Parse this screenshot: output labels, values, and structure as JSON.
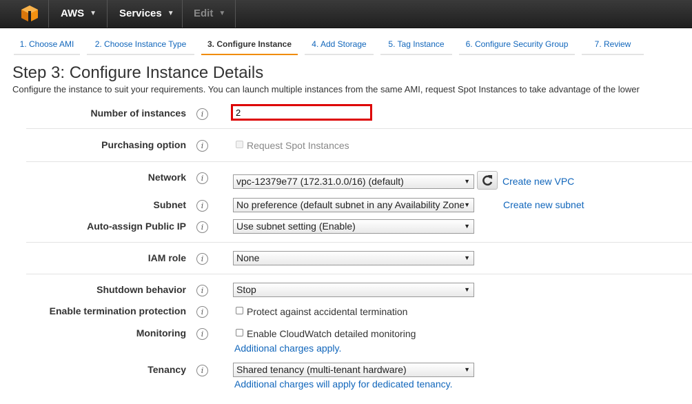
{
  "topbar": {
    "logo_icon": "aws-cube-icon",
    "aws_label": "AWS",
    "services_label": "Services",
    "edit_label": "Edit"
  },
  "wizard": {
    "steps": [
      {
        "label": "1. Choose AMI"
      },
      {
        "label": "2. Choose Instance Type"
      },
      {
        "label": "3. Configure Instance"
      },
      {
        "label": "4. Add Storage"
      },
      {
        "label": "5. Tag Instance"
      },
      {
        "label": "6. Configure Security Group"
      },
      {
        "label": "7. Review"
      }
    ],
    "active_index": 2
  },
  "page": {
    "title": "Step 3: Configure Instance Details",
    "description": "Configure the instance to suit your requirements. You can launch multiple instances from the same AMI, request Spot Instances to take advantage of the lower"
  },
  "form": {
    "number_of_instances": {
      "label": "Number of instances",
      "value": "2"
    },
    "purchasing_option": {
      "label": "Purchasing option",
      "checkbox_label": "Request Spot Instances"
    },
    "network": {
      "label": "Network",
      "value": "vpc-12379e77 (172.31.0.0/16) (default)",
      "link": "Create new VPC"
    },
    "subnet": {
      "label": "Subnet",
      "value": "No preference (default subnet in any Availability Zone)",
      "link": "Create new subnet"
    },
    "auto_assign_ip": {
      "label": "Auto-assign Public IP",
      "value": "Use subnet setting (Enable)"
    },
    "iam_role": {
      "label": "IAM role",
      "value": "None"
    },
    "shutdown_behavior": {
      "label": "Shutdown behavior",
      "value": "Stop"
    },
    "termination_protection": {
      "label": "Enable termination protection",
      "checkbox_label": "Protect against accidental termination"
    },
    "monitoring": {
      "label": "Monitoring",
      "checkbox_label": "Enable CloudWatch detailed monitoring",
      "link": "Additional charges apply."
    },
    "tenancy": {
      "label": "Tenancy",
      "value": "Shared tenancy (multi-tenant hardware)",
      "link": "Additional charges will apply for dedicated tenancy."
    }
  },
  "colors": {
    "link": "#1166bb",
    "active_step_underline": "#f08c00",
    "highlight_border": "#dd0000",
    "topbar": "#2a2a2a"
  }
}
